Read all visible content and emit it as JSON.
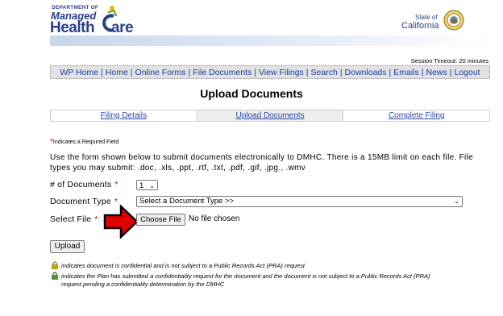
{
  "header": {
    "dept_line": "DEPARTMENT OF",
    "managed": "Managed",
    "health": "Health",
    "care": "are",
    "state_of": "State of",
    "california": "California",
    "session_timeout": "Session Timeout: 20 minutes"
  },
  "nav": {
    "items": [
      "WP Home",
      "Home",
      "Online Forms",
      "File Documents",
      "View Filings",
      "Search",
      "Downloads",
      "Emails",
      "News",
      "Logout"
    ]
  },
  "page_title": "Upload Documents",
  "tabs": [
    "Filing Details",
    "Upload Documents",
    "Complete Filing"
  ],
  "form": {
    "required_note": "Indicates a Required Field",
    "intro": "Use the form shown below to submit documents electronically to DMHC. There is a 15MB limit on each file. File types you may submit: .doc, .xls, .ppt, .rtf, .txt, .pdf, .gif, .jpg., .wmv",
    "num_docs_label": "# of Documents",
    "num_docs_value": "1",
    "doc_type_label": "Document Type",
    "doc_type_value": "Select a Document Type >>",
    "select_file_label": "Select File",
    "choose_file": "Choose File",
    "no_file": "No file chosen",
    "upload_label": "Upload",
    "required_star": "*"
  },
  "notes": {
    "confidential": "indicates document is confidential and is not subject to a Public Records Act (PRA) request",
    "pending_line1": "indicates the Plan has submitted a confidentiality request for the document and the document is not subject to a Public Records Act (PRA)",
    "pending_line2": "request pending a confidentiality determination by the DMHC"
  },
  "colors": {
    "brand": "#2a3f87",
    "link": "#1a3da5",
    "required": "#d00000",
    "arrow": "#e00000",
    "lock_confidential": "#c9a600",
    "lock_pending": "#4a9a2a"
  }
}
